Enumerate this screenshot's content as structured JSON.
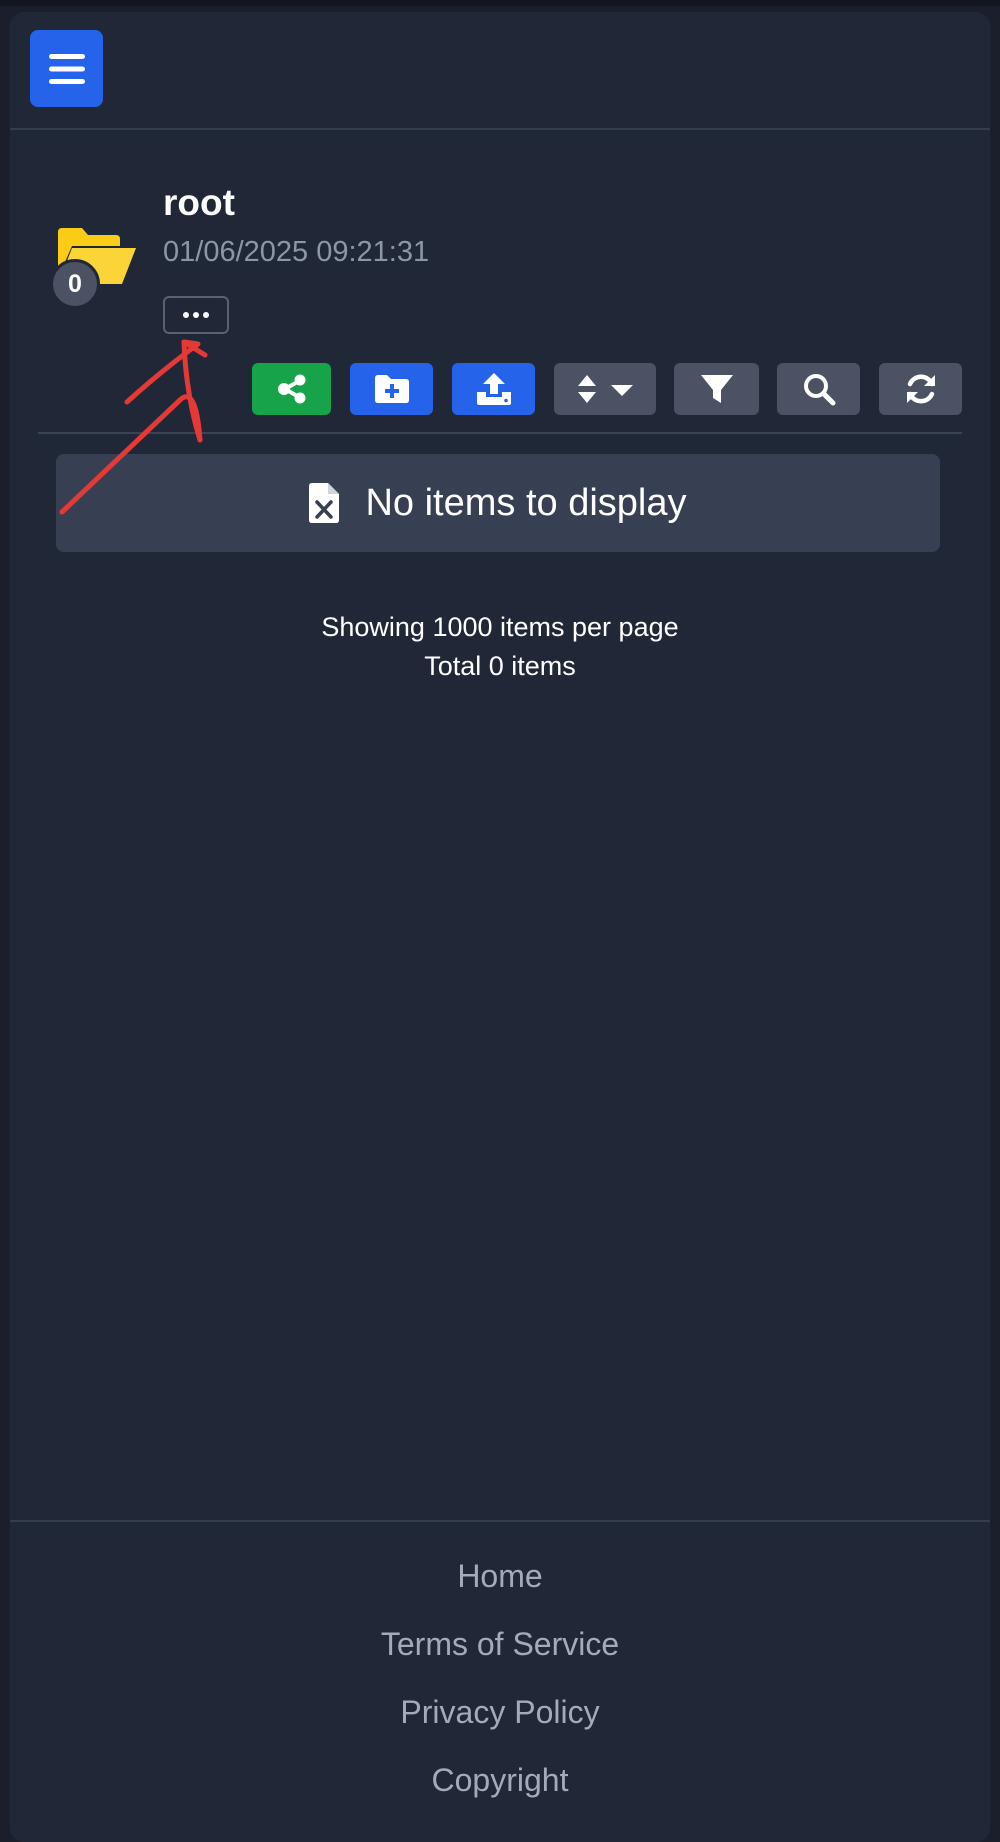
{
  "folder": {
    "name": "root",
    "date": "01/06/2025 09:21:31",
    "item_count": "0"
  },
  "empty_state": {
    "message": "No items to display"
  },
  "paging": {
    "per_page_text": "Showing 1000 items per page",
    "total_text": "Total 0 items"
  },
  "footer": {
    "links": [
      "Home",
      "Terms of Service",
      "Privacy Policy",
      "Copyright"
    ]
  },
  "colors": {
    "primary": "#2563eb",
    "success": "#16a34a",
    "secondary": "#4a5263",
    "folder": "#facc15",
    "annotation": "#e53935"
  },
  "icons": {
    "menu": "hamburger-icon",
    "folder": "folder-open-icon",
    "share": "share-icon",
    "new_folder": "folder-plus-icon",
    "upload": "upload-icon",
    "sort": "sort-icon",
    "filter": "filter-icon",
    "search": "search-icon",
    "refresh": "refresh-icon",
    "empty": "file-excel-icon"
  }
}
